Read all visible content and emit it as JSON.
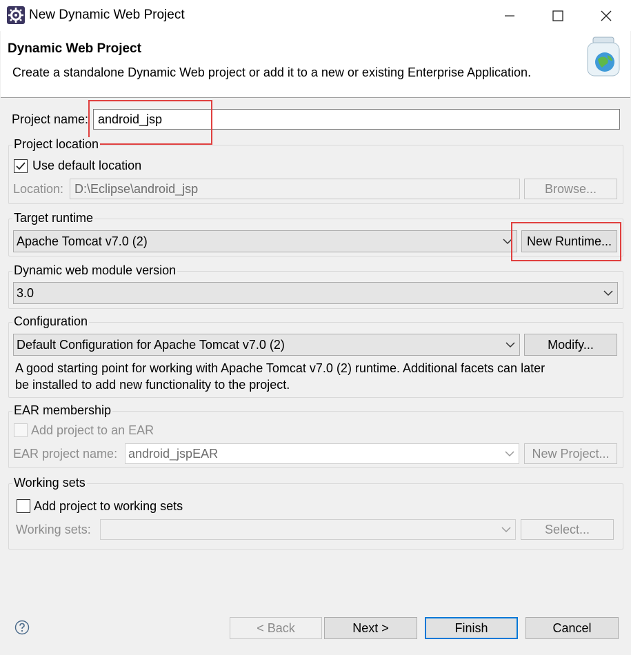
{
  "window": {
    "title": "New Dynamic Web Project",
    "controls": {
      "minimize": "minimize-icon",
      "maximize": "maximize-icon",
      "close": "close-icon"
    }
  },
  "header": {
    "title": "Dynamic Web Project",
    "description": "Create a standalone Dynamic Web project or add it to a new or existing Enterprise Application."
  },
  "project_name": {
    "label": "Project name:",
    "value": "android_jsp"
  },
  "project_location": {
    "group_label": "Project location",
    "use_default_label": "Use default location",
    "use_default_checked": true,
    "location_label": "Location:",
    "location_value": "D:\\Eclipse\\android_jsp",
    "browse_label": "Browse..."
  },
  "target_runtime": {
    "group_label": "Target runtime",
    "selected": "Apache Tomcat v7.0 (2)",
    "new_runtime_label": "New Runtime..."
  },
  "web_module": {
    "group_label": "Dynamic web module version",
    "selected": "3.0"
  },
  "configuration": {
    "group_label": "Configuration",
    "selected": "Default Configuration for Apache Tomcat v7.0 (2)",
    "modify_label": "Modify...",
    "description_line1": "A good starting point for working with Apache Tomcat v7.0 (2) runtime. Additional facets can later",
    "description_line2": "be installed to add new functionality to the project."
  },
  "ear": {
    "group_label": "EAR membership",
    "add_label": "Add project to an EAR",
    "add_checked": false,
    "project_name_label": "EAR project name:",
    "project_name_value": "android_jspEAR",
    "new_project_label": "New Project..."
  },
  "working_sets": {
    "group_label": "Working sets",
    "add_label": "Add project to working sets",
    "add_checked": false,
    "sets_label": "Working sets:",
    "sets_value": "",
    "select_label": "Select..."
  },
  "footer": {
    "back_label": "< Back",
    "next_label": "Next >",
    "finish_label": "Finish",
    "cancel_label": "Cancel"
  },
  "colors": {
    "annotation": "#e0403f",
    "default_button_border": "#0078d7"
  }
}
